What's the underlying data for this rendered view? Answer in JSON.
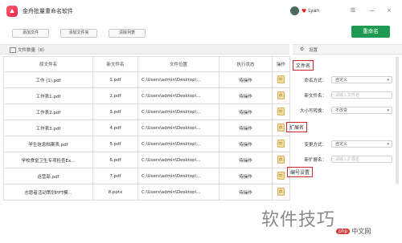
{
  "app": {
    "title": "金舟批量重命名软件"
  },
  "user": {
    "name": "Lyan"
  },
  "window": {
    "close": "×",
    "minimize": "—",
    "menu": "☰"
  },
  "toolbar": {
    "add_file": "添加文件",
    "add_folder": "添加文件夹",
    "clear": "清除列表",
    "rename": "重命名"
  },
  "list": {
    "header": "文件数量（8）",
    "columns": [
      "原文件名",
      "新文件名",
      "文件位置",
      "执行状态",
      "操作"
    ],
    "rows": [
      {
        "orig": "工作 (1).pdf",
        "new": "1.pdf",
        "path": "C:\\Users\\admin\\Desktop\\...",
        "status": "待操作"
      },
      {
        "orig": "工作表1.pdf",
        "new": "2.pdf",
        "path": "C:\\Users\\admin\\Desktop\\...",
        "status": "待操作"
      },
      {
        "orig": "工作表2.pdf",
        "new": "3.pdf",
        "path": "C:\\Users\\admin\\Desktop\\...",
        "status": "待操作"
      },
      {
        "orig": "工作表3.pdf",
        "new": "4.pdf",
        "path": "C:\\Users\\admin\\Desktop\\...",
        "status": "待操作"
      },
      {
        "orig": "学生信息档案表.pdf",
        "new": "5.pdf",
        "path": "C:\\Users\\admin\\Desktop\\...",
        "status": "待操作"
      },
      {
        "orig": "学校食堂卫生专项检查Ex...",
        "new": "6.pdf",
        "path": "C:\\Users\\admin\\Desktop\\...",
        "status": "待操作"
      },
      {
        "orig": "运营部.pdf",
        "new": "7.pdf",
        "path": "C:\\Users\\admin\\Desktop\\...",
        "status": "待操作"
      },
      {
        "orig": "志愿者活动策划PPT模...",
        "new": "8.pptx",
        "path": "C:\\Users\\admin\\Desktop\\...",
        "status": "待操作"
      }
    ]
  },
  "settings": {
    "header": "设置",
    "filename_section": "文件名",
    "naming_method_label": "命名方式：",
    "naming_method_value": "自定义",
    "new_filename_label": "新文件名：",
    "new_filename_placeholder": "请输入文件名",
    "case_label": "大小写转换：",
    "case_value": "不改变",
    "ext_section": "扩展名",
    "change_method_label": "变更方式：",
    "change_method_value": "自定义",
    "new_ext_label": "新扩展名：",
    "new_ext_placeholder": "请输入扩展名",
    "number_section": "编号设置"
  },
  "watermark": {
    "text": "软件技巧",
    "site_badge": "php",
    "site_text": "中文网"
  },
  "colors": {
    "primary_green": "#1f9a52",
    "highlight_red": "#cc2a2a"
  }
}
